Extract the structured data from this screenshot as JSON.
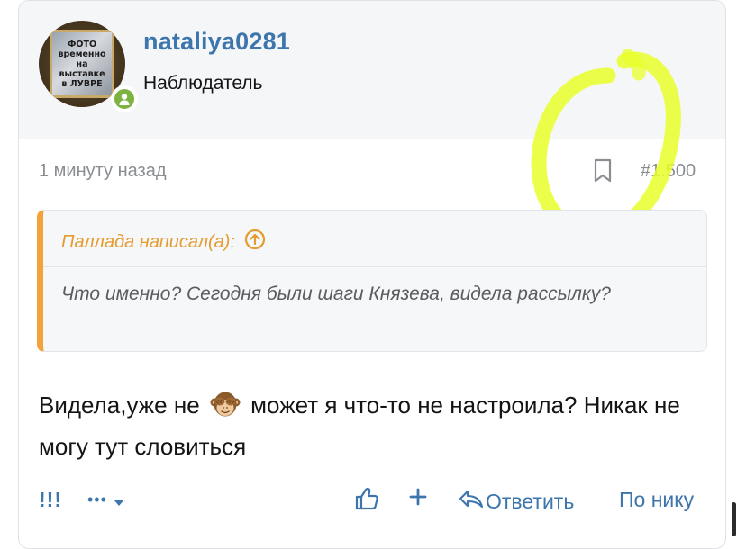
{
  "user": {
    "username": "nataliya0281",
    "role": "Наблюдатель",
    "avatar_text": "ФОТО\nвременно\nна\nвыставке\nв ЛУВРЕ",
    "status": "online"
  },
  "post": {
    "time": "1 минуту назад",
    "number": "#1.500"
  },
  "quote": {
    "author_label": "Паллада написал(а):",
    "text": "Что именно? Сегодня были шаги Князева, видела рассылку?"
  },
  "message": {
    "part1": "Видела,уже не",
    "emoji": "see-no-evil-monkey",
    "part2": "может я что-то не настроила? Никак не могу тут словиться"
  },
  "actions": {
    "report": "!!!",
    "more": "•••",
    "reply": "Ответить",
    "by_nick": "По нику"
  },
  "colors": {
    "link": "#3d75ad",
    "quote_accent": "#f3a33a",
    "online": "#7cb342",
    "highlight": "#e8ff2a"
  }
}
